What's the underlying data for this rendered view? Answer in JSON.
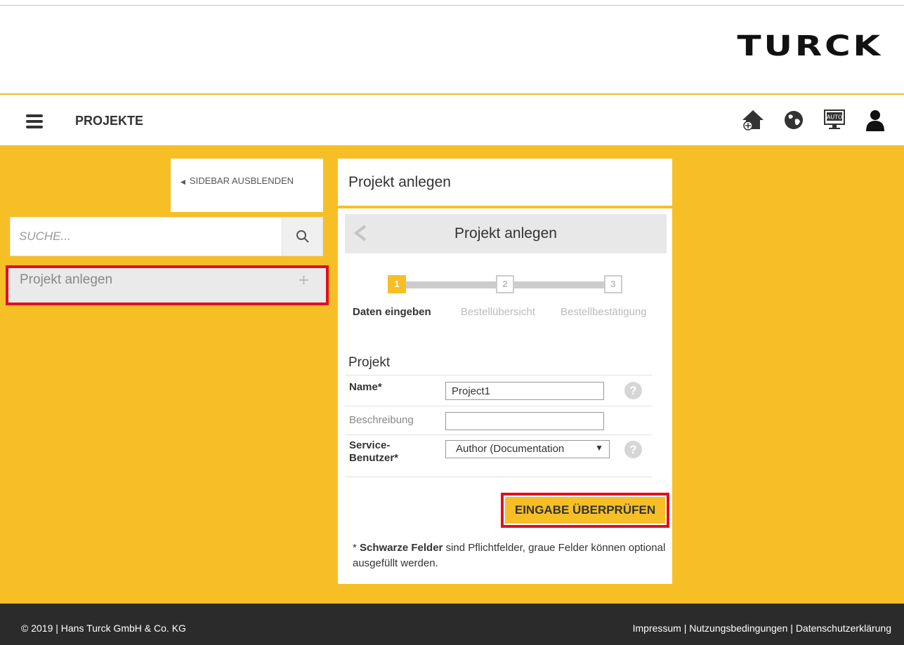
{
  "brand": {
    "logo_text": "TURCK",
    "accent_color": "#f6bf26",
    "highlight_color": "#e0101e"
  },
  "header": {
    "menu_icon": "hamburger-menu-icon",
    "title": "PROJEKTE",
    "icons": [
      "home-add-icon",
      "globe-icon",
      "auto-monitor-icon",
      "user-icon"
    ],
    "auto_label": "AUTO"
  },
  "sidebar": {
    "toggle_label": "SIDEBAR AUSBLENDEN",
    "search_placeholder": "SUCHE...",
    "items": [
      {
        "label": "Projekt anlegen",
        "action_icon": "+"
      }
    ]
  },
  "panel": {
    "title": "Projekt anlegen",
    "subtitle": "Projekt anlegen",
    "steps": [
      {
        "number": "1",
        "label": "Daten eingeben",
        "active": true
      },
      {
        "number": "2",
        "label": "Bestellübersicht",
        "active": false
      },
      {
        "number": "3",
        "label": "Bestellbestätigung",
        "active": false
      }
    ],
    "form": {
      "heading": "Projekt",
      "name_label": "Name*",
      "name_value": "Project1",
      "description_label": "Beschreibung",
      "description_value": "",
      "service_user_label_line1": "Service-",
      "service_user_label_line2": "Benutzer*",
      "service_user_value": "Author (Documentation",
      "help_icon": "?"
    },
    "check_button": "EINGABE ÜBERPRÜFEN",
    "note_bold": "Schwarze Felder",
    "note_prefix": "* ",
    "note_rest": " sind Pflichtfelder, graue Felder können optional ausgefüllt werden."
  },
  "footer": {
    "copyright": "© 2019 | Hans Turck GmbH & Co. KG",
    "links": [
      "Impressum",
      "Nutzungsbedingungen",
      "Datenschutzerklärung"
    ],
    "separator": " | "
  }
}
